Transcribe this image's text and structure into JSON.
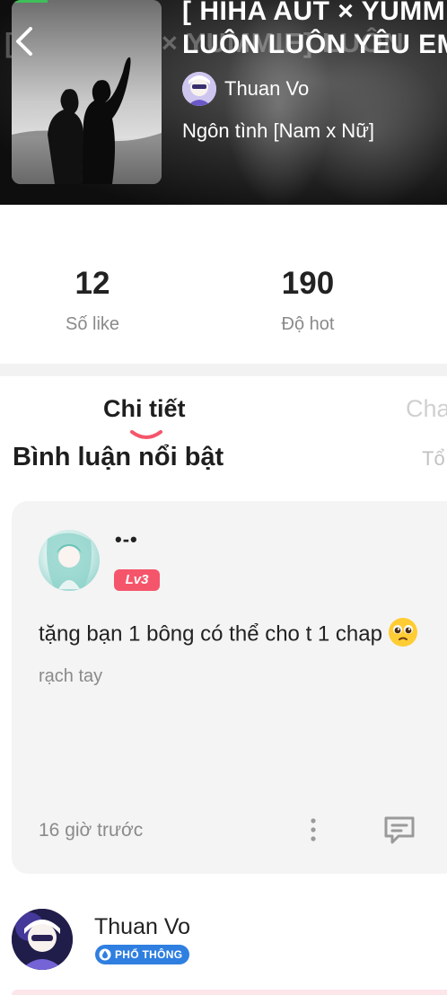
{
  "header": {
    "title_line1": "[ HIHA AUT × YUMM",
    "title_line2": "LUÔN LUÔN YÊU EM",
    "blurred_title": "[HIHA AUT × YUMMIE] LUÔN",
    "author_name": "Thuan Vo",
    "genre": "Ngôn tình [Nam x Nữ]"
  },
  "stats": [
    {
      "value": "12",
      "label": "Số like"
    },
    {
      "value": "190",
      "label": "Độ hot"
    }
  ],
  "tabs": [
    {
      "label": "Chi tiết",
      "active": true
    },
    {
      "label": "Cha",
      "active": false
    }
  ],
  "section": {
    "title": "Bình luận nổi bật",
    "link": "Tổ"
  },
  "comment": {
    "username": "•-•",
    "level": "Lv3",
    "text": "tặng bạn 1 bông có thể cho t 1 chap",
    "subtext": "rạch tay",
    "time": "16 giờ trước"
  },
  "next_user": {
    "name": "Thuan Vo",
    "badge": "PHỔ THÔNG"
  },
  "colors": {
    "accent_pink": "#f5556b",
    "badge_blue": "#2f7fe0",
    "muted_text": "#8a8a8a"
  }
}
